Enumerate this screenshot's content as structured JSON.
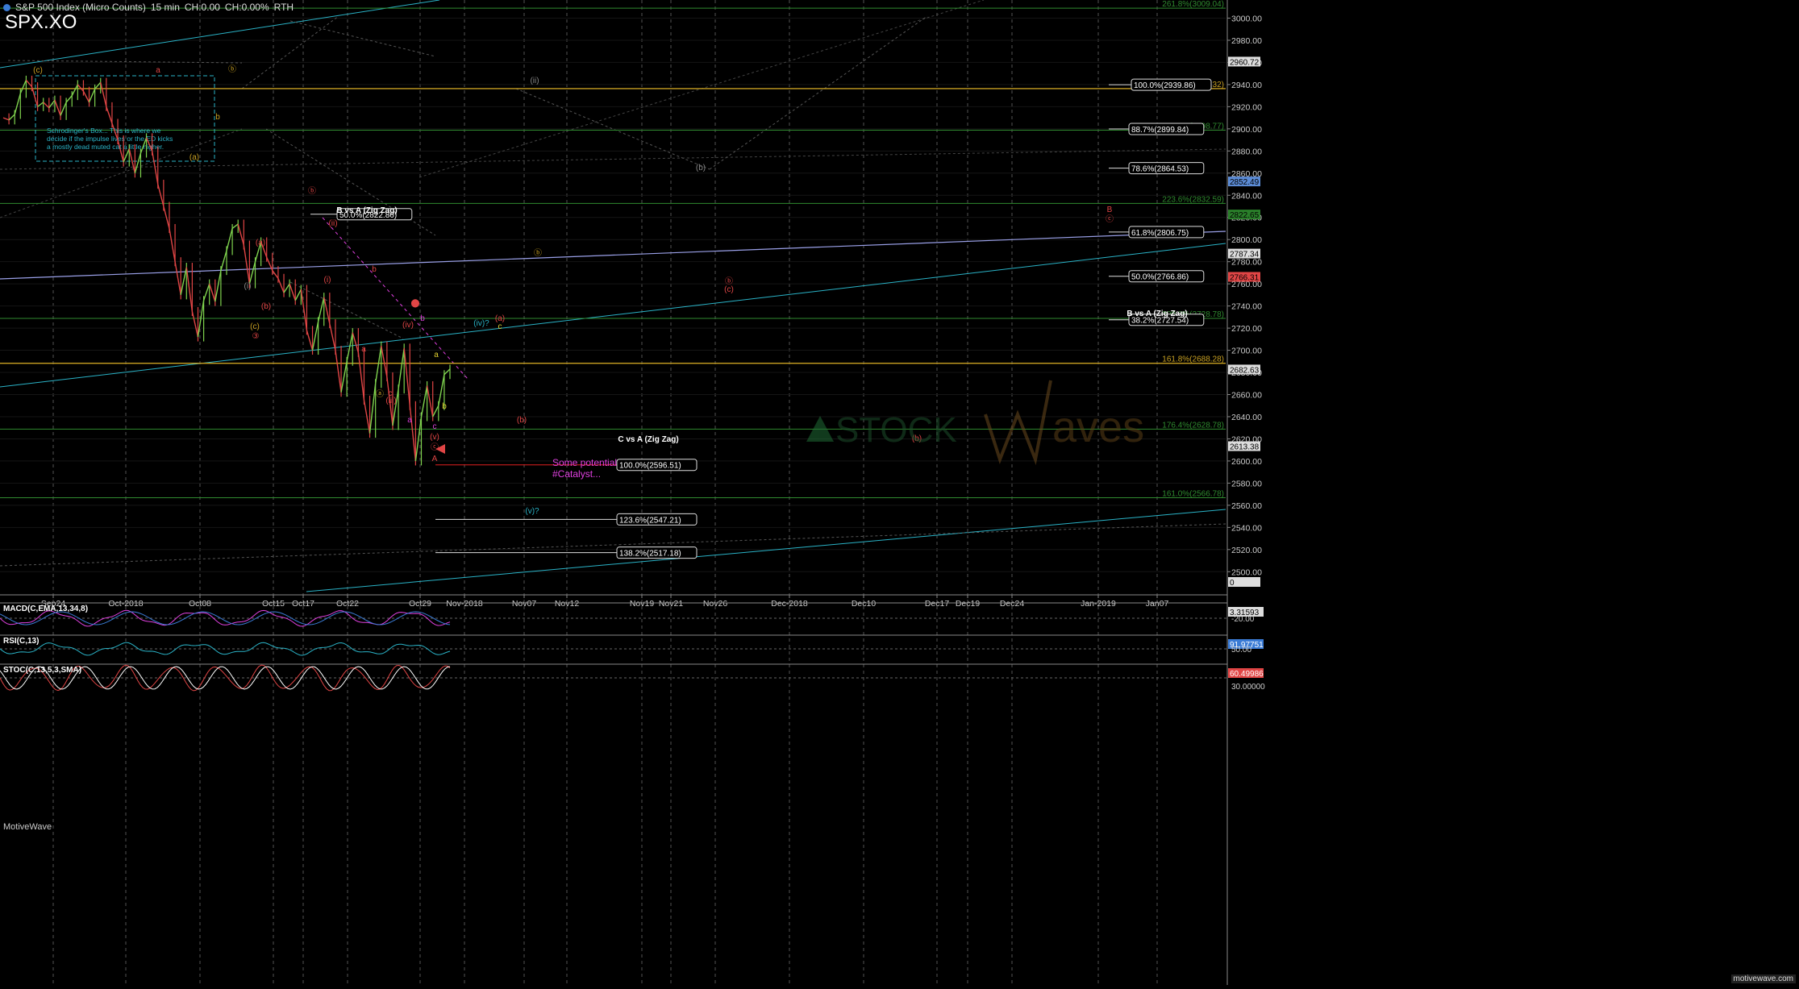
{
  "header": {
    "title": "S&P 500 Index (Micro Counts)",
    "interval": "15 min",
    "change": "CH:0.00",
    "change_pct": "CH:0.00%",
    "session": "RTH",
    "symbol": "SPX.XO"
  },
  "footer": {
    "brand": "MotiveWave",
    "watermark": "motivewave.com"
  },
  "colors": {
    "background": "#000000",
    "up_candle": "#7fd34e",
    "down_candle": "#e04545",
    "gold": "#c8a022",
    "green_fib": "#2f8a2f",
    "cyan": "#2ab3c7",
    "magenta": "#e040e0",
    "red_label": "#e02020"
  },
  "annotations": {
    "schrodinger": [
      "Schrodinger's Box... This is where we",
      "decide if the impulse lives or the ED kicks",
      "a mostly dead muted cat a little higher."
    ],
    "catalyst": [
      "Some potential",
      "#Catalyst..."
    ],
    "bvsa_top": "B vs A (Zig Zag)",
    "bvsa_right": "B vs A (Zig Zag)",
    "cvsa": "C vs A (Zig Zag)"
  },
  "chart_data": [
    {
      "type": "line",
      "title": "S&P 500 Index (Micro Counts)",
      "x_tick_labels": [
        "Sep24",
        "Oct-2018",
        "Oct08",
        "Oct15",
        "Oct17",
        "Oct22",
        "Oct29",
        "Nov-2018",
        "Nov07",
        "Nov12",
        "Nov19",
        "Nov21",
        "Nov26",
        "Dec-2018",
        "Dec10",
        "Dec17",
        "Dec19",
        "Dec24",
        "Jan-2019",
        "Jan07"
      ],
      "y_tick_labels": [
        "3000.00",
        "2980.00",
        "2960.00",
        "2940.00",
        "2920.00",
        "2900.00",
        "2880.00",
        "2860.00",
        "2840.00",
        "2820.00",
        "2800.00",
        "2780.00",
        "2760.00",
        "2740.00",
        "2720.00",
        "2700.00",
        "2680.00",
        "2660.00",
        "2640.00",
        "2620.00",
        "2600.00",
        "2580.00",
        "2560.00",
        "2540.00",
        "2520.00",
        "2500.00"
      ],
      "ylim": [
        2482,
        3012
      ],
      "price_markers": [
        "2960.72",
        "2852.49",
        "2822.65",
        "2787.34",
        "2766.31",
        "2682.63",
        "2613.38",
        "0"
      ],
      "fib_right": [
        {
          "label": "261.8%(3009.04)",
          "value": 3009.04
        },
        {
          "label": "223.6%(2832.59)",
          "value": 2832.59
        },
        {
          "label": "200.0%(2728.78)",
          "value": 2728.78
        },
        {
          "label": "161.8%(2688.28)",
          "value": 2688.28
        },
        {
          "label": "176.4%(2628.78)",
          "value": 2628.78
        },
        {
          "label": "161.0%(2566.78)",
          "value": 2566.78
        },
        {
          "label": "2.4%(2936.32)",
          "value": 2936.32
        },
        {
          "label": "2%(2898.77)",
          "value": 2898.77
        }
      ],
      "fib_boxes": [
        {
          "label": "100.0%(2939.86)",
          "value": 2939.86
        },
        {
          "label": "88.7%(2899.84)",
          "value": 2899.84
        },
        {
          "label": "78.6%(2864.53)",
          "value": 2864.53
        },
        {
          "label": "61.8%(2806.75)",
          "value": 2806.75
        },
        {
          "label": "50.0%(2766.86)",
          "value": 2766.86
        },
        {
          "label": "38.2%(2727.54)",
          "value": 2727.54
        },
        {
          "label": "50.0%(2822.86)",
          "value": 2822.86
        },
        {
          "label": "100.0%(2596.51)",
          "value": 2596.51
        },
        {
          "label": "123.6%(2547.21)",
          "value": 2547.21
        },
        {
          "label": "138.2%(2517.18)",
          "value": 2517.18
        }
      ],
      "price_path": [
        [
          0,
          2910
        ],
        [
          1,
          2908
        ],
        [
          2,
          2913
        ],
        [
          3,
          2932
        ],
        [
          4,
          2944
        ],
        [
          5,
          2938
        ],
        [
          6,
          2920
        ],
        [
          7,
          2924
        ],
        [
          8,
          2919
        ],
        [
          9,
          2926
        ],
        [
          10,
          2912
        ],
        [
          11,
          2924
        ],
        [
          12,
          2930
        ],
        [
          13,
          2940
        ],
        [
          14,
          2934
        ],
        [
          15,
          2924
        ],
        [
          16,
          2936
        ],
        [
          17,
          2942
        ],
        [
          18,
          2920
        ],
        [
          19,
          2905
        ],
        [
          20,
          2890
        ],
        [
          21,
          2870
        ],
        [
          22,
          2882
        ],
        [
          23,
          2860
        ],
        [
          24,
          2878
        ],
        [
          25,
          2892
        ],
        [
          26,
          2880
        ],
        [
          27,
          2850
        ],
        [
          28,
          2830
        ],
        [
          29,
          2810
        ],
        [
          30,
          2780
        ],
        [
          31,
          2750
        ],
        [
          32,
          2775
        ],
        [
          33,
          2735
        ],
        [
          34,
          2712
        ],
        [
          35,
          2745
        ],
        [
          36,
          2760
        ],
        [
          37,
          2744
        ],
        [
          38,
          2772
        ],
        [
          39,
          2790
        ],
        [
          40,
          2810
        ],
        [
          41,
          2814
        ],
        [
          42,
          2795
        ],
        [
          43,
          2760
        ],
        [
          44,
          2780
        ],
        [
          45,
          2798
        ],
        [
          46,
          2784
        ],
        [
          47,
          2772
        ],
        [
          48,
          2765
        ],
        [
          49,
          2752
        ],
        [
          50,
          2760
        ],
        [
          51,
          2745
        ],
        [
          52,
          2755
        ],
        [
          53,
          2718
        ],
        [
          54,
          2700
        ],
        [
          55,
          2726
        ],
        [
          56,
          2748
        ],
        [
          57,
          2724
        ],
        [
          58,
          2700
        ],
        [
          59,
          2662
        ],
        [
          60,
          2690
        ],
        [
          61,
          2716
        ],
        [
          62,
          2698
        ],
        [
          63,
          2655
        ],
        [
          64,
          2625
        ],
        [
          65,
          2670
        ],
        [
          66,
          2704
        ],
        [
          67,
          2676
        ],
        [
          68,
          2632
        ],
        [
          69,
          2665
        ],
        [
          70,
          2702
        ],
        [
          71,
          2650
        ],
        [
          72,
          2600
        ],
        [
          73,
          2640
        ],
        [
          74,
          2668
        ],
        [
          75,
          2640
        ],
        [
          76,
          2650
        ],
        [
          77,
          2678
        ],
        [
          78,
          2683
        ]
      ]
    },
    {
      "type": "line",
      "title": "MACD(C,EMA,13,34,8)",
      "value_label": "3.31593",
      "y_tick_labels": [
        "-20.00"
      ]
    },
    {
      "type": "line",
      "title": "RSI(C,13)",
      "value_label": "91.97751",
      "y_tick_labels": [
        "50.00"
      ]
    },
    {
      "type": "line",
      "title": "STOC(C,13,5,3,SMA)",
      "value_label": "60.49986",
      "y_tick_labels": [
        "30.00000"
      ]
    }
  ]
}
